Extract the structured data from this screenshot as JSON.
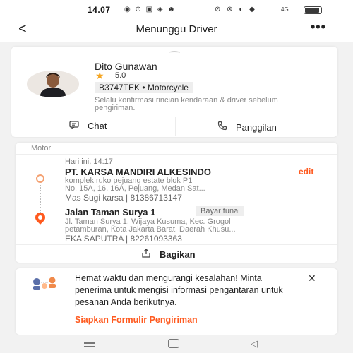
{
  "status_bar": {
    "time": "14.07",
    "left_icons": "◉ ⊙ ▣ ◈ ☻",
    "right_icons": "⊘ ⊗ ◐ ◆",
    "network_label": "4G",
    "battery_level": 0.9
  },
  "header": {
    "back_icon": "chevron-left-icon",
    "back_glyph": "<",
    "title": "Menunggu Driver",
    "more_glyph": "•••"
  },
  "driver": {
    "name": "Dito Gunawan",
    "rating": "5.0",
    "plate_and_vehicle": "B3747TEK • Motorcycle",
    "confirm_text": "Selalu konfirmasi rincian kendaraan & driver sebelum pengiriman.",
    "chat_label": "Chat",
    "call_label": "Panggilan"
  },
  "route": {
    "section_label": "Motor",
    "time_label": "Hari ini, 14:17",
    "pickup": {
      "name": "PT. KARSA MANDIRI ALKESINDO",
      "edit_label": "edit",
      "address_line1": "komplek ruko pejuang estate blok P1",
      "address_line2": "No. 15A, 16, 16A, Pejuang, Medan Sat...",
      "contact": "Mas Sugi karsa | 81386713147"
    },
    "dropoff": {
      "name": "Jalan Taman Surya 1",
      "payment_badge": "Bayar tunai",
      "address_line1": "Jl. Taman Surya 1, Wijaya Kusuma, Kec. Grogol",
      "address_line2": "petamburan, Kota Jakarta Barat, Daerah Khusu...",
      "contact": "EKA SAPUTRA | 82261093363"
    },
    "share_label": "Bagikan"
  },
  "promo": {
    "text": "Hemat waktu dan mengurangi kesalahan! Minta penerima untuk mengisi informasi pengantaran untuk pesanan Anda berikutnya.",
    "link_label": "Siapkan Formulir Pengiriman",
    "close_glyph": "✕"
  },
  "colors": {
    "accent": "#ff5a1f",
    "star": "#f5a623"
  }
}
